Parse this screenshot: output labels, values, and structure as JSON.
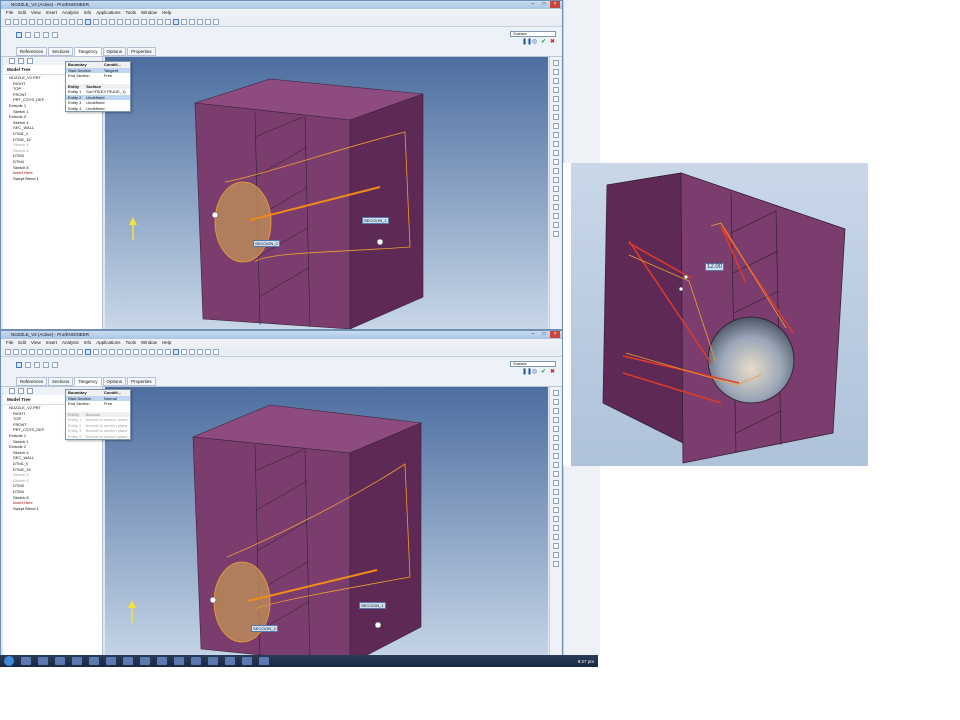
{
  "window_top": {
    "title": "NOZZLE_V2 (Active) - Pro/ENGINEER",
    "menu": [
      "File",
      "Edit",
      "View",
      "Insert",
      "Analysis",
      "Info",
      "Applications",
      "Tools",
      "Window",
      "Help"
    ],
    "dash_tabs": [
      "References",
      "Sections",
      "Tangency",
      "Options",
      "Properties"
    ],
    "surface_select": "Surface",
    "panel": {
      "boundary_header": [
        "Boundary",
        "Conditi..."
      ],
      "boundaries": [
        [
          "Start Section",
          "Tangent"
        ],
        [
          "End Section",
          "Free"
        ]
      ],
      "entity_header": [
        "Entity",
        "Surface"
      ],
      "entities": [
        [
          "Entity 1",
          "Surf:F5(EXTRUDE_1)"
        ],
        [
          "Entity 2",
          "Undefined"
        ],
        [
          "Entity 3",
          "Undefined"
        ],
        [
          "Entity 4",
          "Undefined"
        ]
      ]
    },
    "dim_labels": [
      "SECCION_2",
      "SECCION_1"
    ]
  },
  "window_bottom": {
    "title": "NOZZLE_V2 (Active) - Pro/ENGINEER",
    "menu": [
      "File",
      "Edit",
      "View",
      "Insert",
      "Analysis",
      "Info",
      "Applications",
      "Tools",
      "Window",
      "Help"
    ],
    "dash_tabs": [
      "References",
      "Sections",
      "Tangency",
      "Options",
      "Properties"
    ],
    "surface_select": "Surface",
    "panel": {
      "boundary_header": [
        "Boundary",
        "Conditi..."
      ],
      "boundaries": [
        [
          "Start Section",
          "Normal"
        ],
        [
          "End Section",
          "Free"
        ]
      ],
      "entity_header": [
        "Entity",
        "Surface"
      ],
      "entities": [
        [
          "Entity 1",
          "Normal to section plane"
        ],
        [
          "Entity 2",
          "Normal to section plane"
        ],
        [
          "Entity 3",
          "Normal to section plane"
        ],
        [
          "Entity 4",
          "Normal to section plane"
        ]
      ]
    },
    "dim_labels": [
      "SECCION_2",
      "SECCION_1"
    ]
  },
  "model_tree": {
    "title": "Model Tree",
    "items": [
      "NOZZLE_V2.PRT",
      "RIGHT",
      "TOP",
      "FRONT",
      "PRT_CSYS_DEF",
      "Extrude 1",
      "Sketch 1",
      "Extrude 2",
      "Sketch 4",
      "SEC_WALL",
      "DTM1_0",
      "DTM2_15",
      "Sketch 5",
      "Sketch 6",
      "DTM3",
      "DTM4",
      "Sketch 8",
      "Insert Here",
      "Swept Blend 1"
    ]
  },
  "inset": {
    "dim_value": "12.00"
  },
  "taskbar": {
    "clock": "8:27 pm"
  },
  "colors": {
    "part": "#7a3d6e",
    "part_dark": "#5e2a55",
    "part_light": "#8e4b80",
    "orange": "#f08a1a",
    "red_sketch": "#e23a2a",
    "background_top": "#4d6ea0",
    "background_bottom": "#c8d7e8"
  }
}
